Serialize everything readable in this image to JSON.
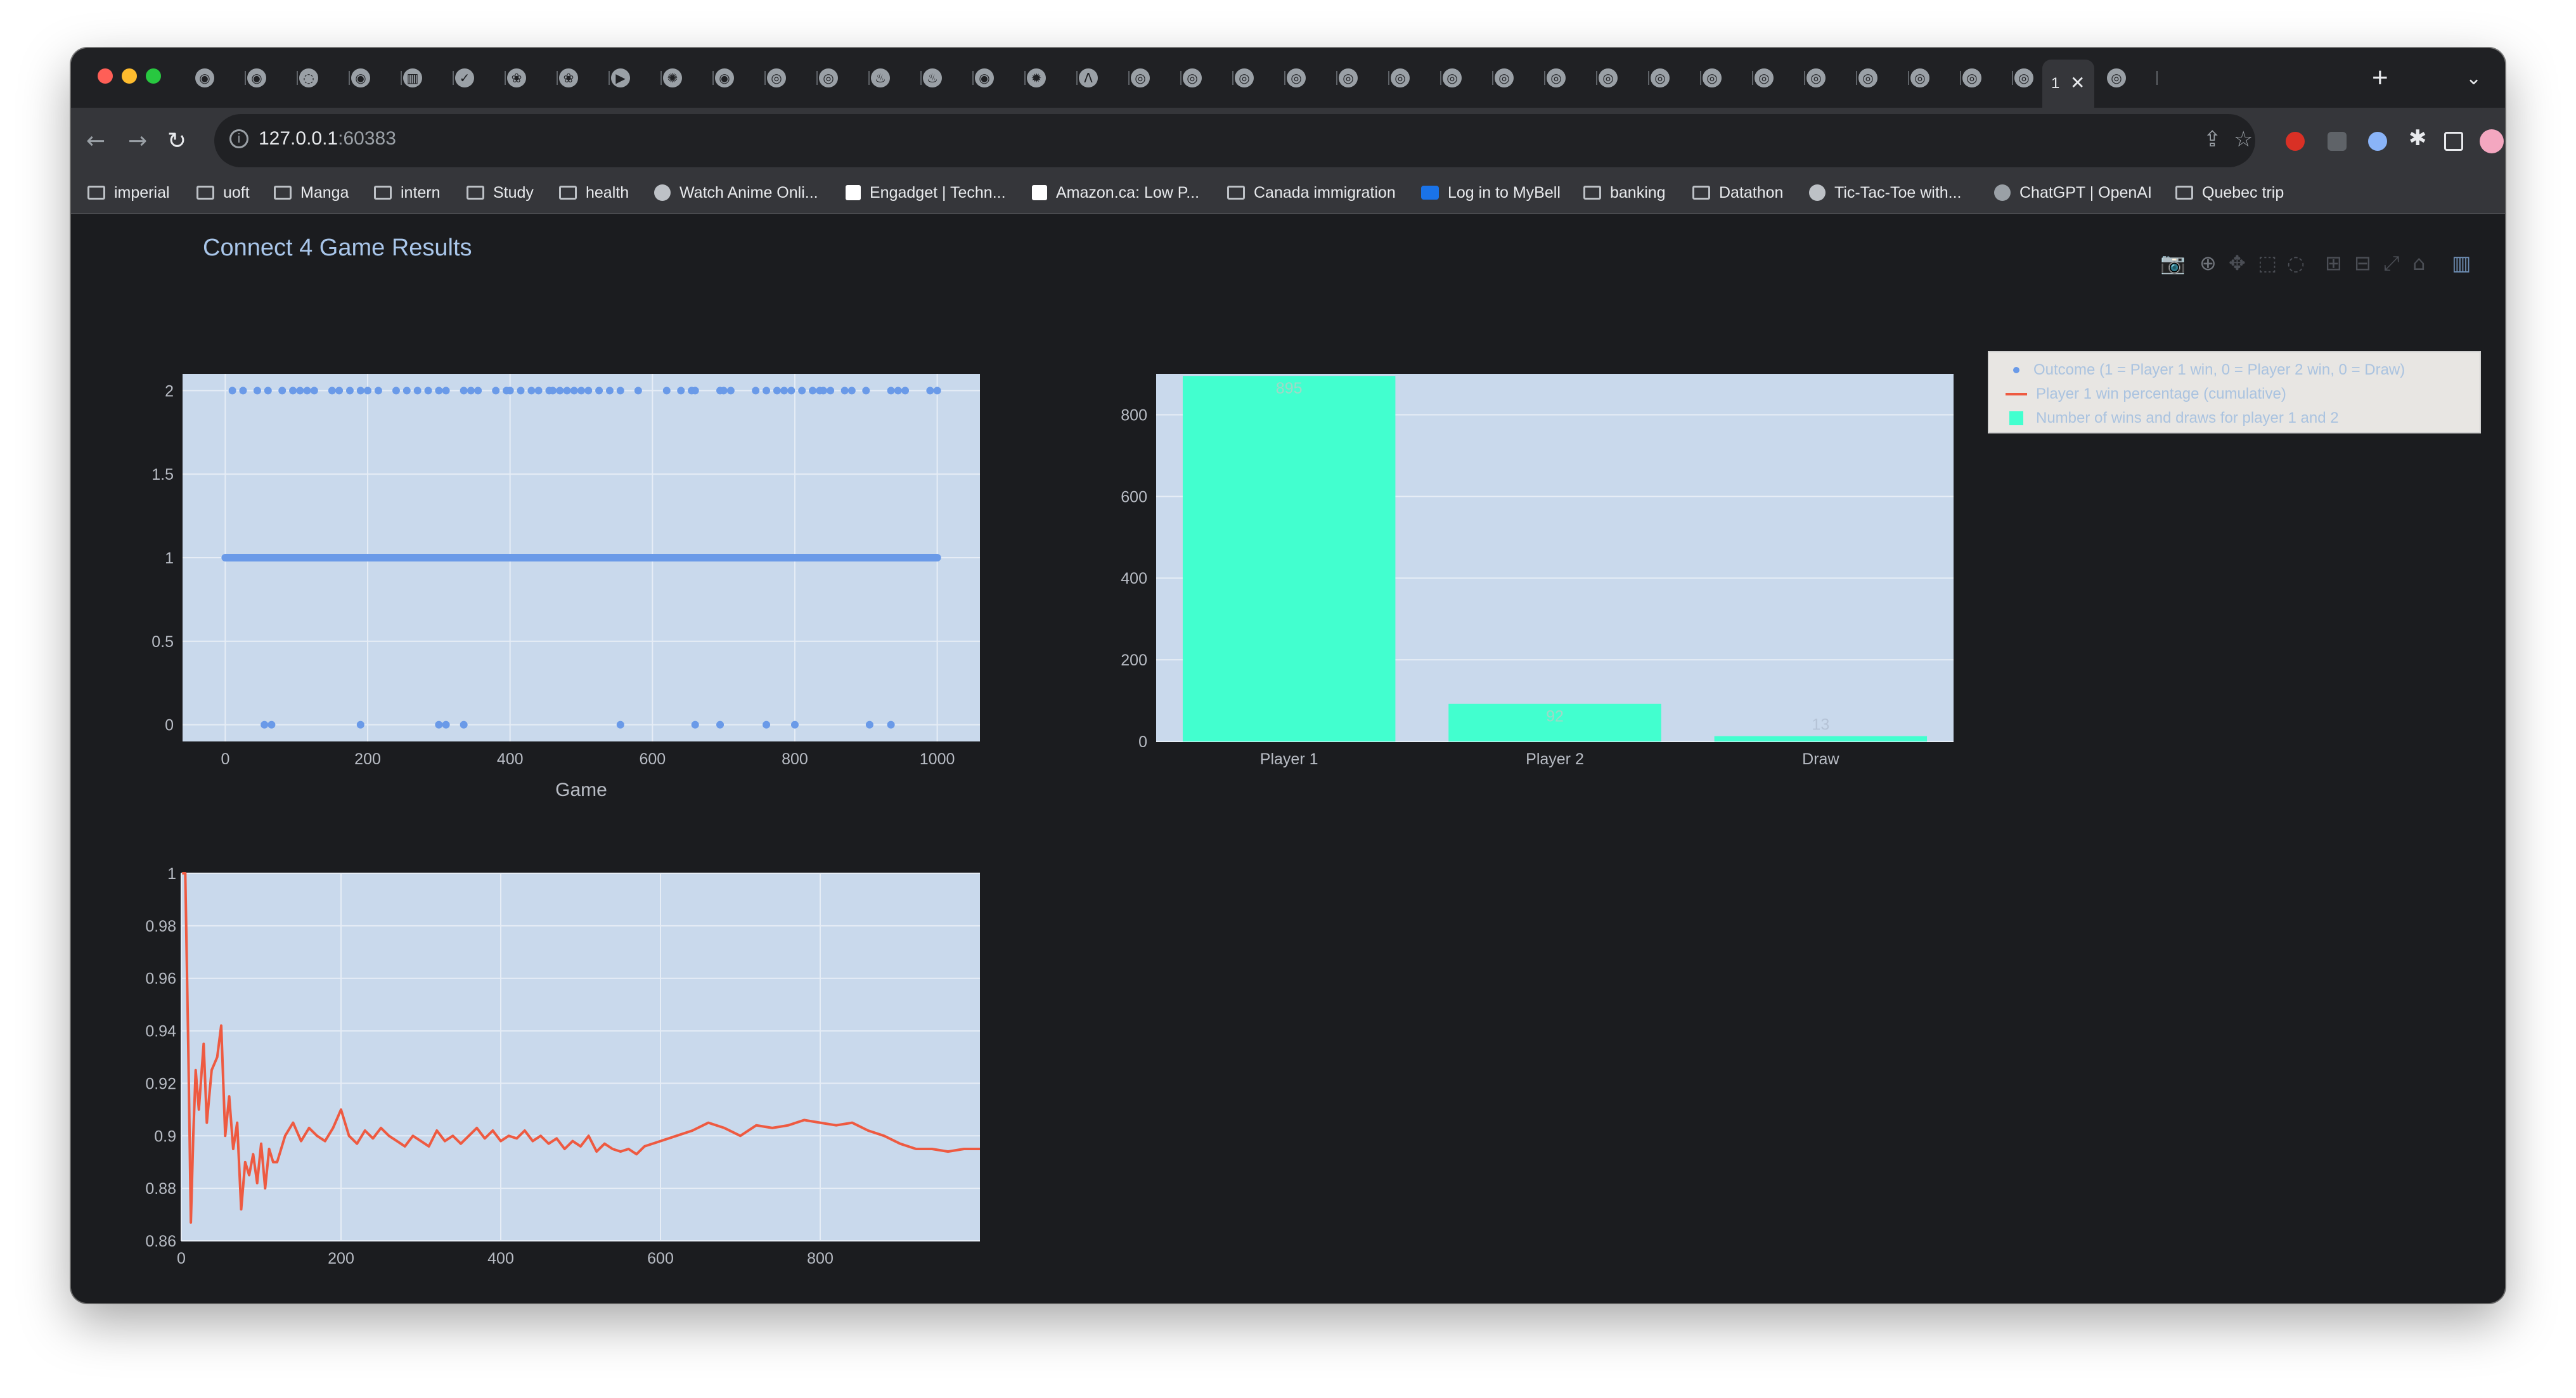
{
  "browser": {
    "active_tab_label": "1",
    "active_tab_close": "✕",
    "new_tab": "+",
    "tab_menu": "⌄",
    "url_host": "127.0.0.1",
    "url_port": ":60383",
    "nav": {
      "back": "←",
      "forward": "→",
      "reload": "↻"
    },
    "bookmarks": [
      {
        "label": "imperial",
        "icon": "folder-icon"
      },
      {
        "label": "uoft",
        "icon": "folder-icon"
      },
      {
        "label": "Manga",
        "icon": "folder-icon"
      },
      {
        "label": "intern",
        "icon": "folder-icon"
      },
      {
        "label": "Study",
        "icon": "folder-icon"
      },
      {
        "label": "health",
        "icon": "folder-icon"
      },
      {
        "label": "Watch Anime Onli...",
        "icon": "globe-icon"
      },
      {
        "label": "Engadget | Techn...",
        "icon": "engadget-icon"
      },
      {
        "label": "Amazon.ca: Low P...",
        "icon": "amazon-icon"
      },
      {
        "label": "Canada immigration",
        "icon": "folder-icon"
      },
      {
        "label": "Log in to MyBell",
        "icon": "bell-icon"
      },
      {
        "label": "banking",
        "icon": "folder-icon"
      },
      {
        "label": "Datathon",
        "icon": "folder-icon"
      },
      {
        "label": "Tic-Tac-Toe with...",
        "icon": "globe-icon"
      },
      {
        "label": "ChatGPT | OpenAI",
        "icon": "openai-icon"
      },
      {
        "label": "Quebec trip",
        "icon": "folder-icon"
      }
    ]
  },
  "page": {
    "title": "Connect 4 Game Results"
  },
  "legend": [
    "Outcome (1 = Player 1 win, 0 = Player 2 win, 0 = Draw)",
    "Player 1 win percentage (cumulative)",
    "Number of wins and draws for player 1 and 2"
  ],
  "colors": {
    "outcome": "#6a9ae8",
    "winpct": "#ee5a41",
    "bars": "#42ffcf",
    "plot_bg": "#c9d9ec"
  },
  "chart_data": [
    {
      "type": "scatter",
      "series_name": "Outcome (1 = Player 1 win, 0 = Player 2 win, 0 = Draw)",
      "xlabel": "Game",
      "xlim": [
        -60,
        1060
      ],
      "ylim": [
        -0.1,
        2.1
      ],
      "xticks": [
        0,
        200,
        400,
        600,
        800,
        1000
      ],
      "yticks": [
        0,
        0.5,
        1,
        1.5,
        2
      ],
      "ytick_labels": [
        "0",
        "0.5",
        "1",
        "1.5",
        "2"
      ],
      "y1_range": [
        0,
        1000
      ],
      "y2_points": [
        10,
        25,
        45,
        60,
        80,
        95,
        105,
        115,
        125,
        150,
        160,
        175,
        190,
        200,
        215,
        240,
        255,
        270,
        285,
        300,
        310,
        335,
        345,
        355,
        380,
        395,
        400,
        415,
        430,
        440,
        455,
        460,
        470,
        480,
        490,
        500,
        510,
        525,
        540,
        555,
        580,
        620,
        640,
        655,
        660,
        695,
        700,
        710,
        745,
        760,
        775,
        785,
        795,
        810,
        825,
        835,
        840,
        850,
        870,
        880,
        900,
        935,
        945,
        955,
        990,
        1000
      ],
      "y0_points": [
        55,
        65,
        190,
        300,
        310,
        335,
        555,
        660,
        695,
        760,
        800,
        905,
        935
      ]
    },
    {
      "type": "bar",
      "series_name": "Number of wins and draws for player 1 and 2",
      "categories": [
        "Player 1",
        "Player 2",
        "Draw"
      ],
      "values": [
        895,
        92,
        13
      ],
      "labels": [
        "895",
        "92",
        "13"
      ],
      "ylim": [
        0,
        900
      ],
      "yticks": [
        0,
        200,
        400,
        600,
        800
      ]
    },
    {
      "type": "line",
      "series_name": "Player 1 win percentage (cumulative)",
      "xlim": [
        0,
        1000
      ],
      "ylim": [
        0.86,
        1.0
      ],
      "xticks": [
        0,
        200,
        400,
        600,
        800
      ],
      "yticks": [
        0.86,
        0.88,
        0.9,
        0.92,
        0.94,
        0.96,
        0.98,
        1
      ],
      "ytick_labels": [
        "0.86",
        "0.88",
        "0.9",
        "0.92",
        "0.94",
        "0.96",
        "0.98",
        "1"
      ],
      "x": [
        1,
        5,
        9,
        12,
        15,
        18,
        22,
        28,
        32,
        38,
        45,
        50,
        55,
        60,
        65,
        70,
        75,
        80,
        85,
        90,
        95,
        100,
        105,
        110,
        115,
        120,
        130,
        140,
        150,
        160,
        170,
        180,
        190,
        200,
        210,
        220,
        230,
        240,
        250,
        260,
        270,
        280,
        290,
        300,
        310,
        320,
        330,
        340,
        350,
        360,
        370,
        380,
        390,
        400,
        410,
        420,
        430,
        440,
        450,
        460,
        470,
        480,
        490,
        500,
        510,
        520,
        530,
        540,
        550,
        560,
        570,
        580,
        600,
        620,
        640,
        660,
        680,
        700,
        720,
        740,
        760,
        780,
        800,
        820,
        840,
        860,
        880,
        900,
        920,
        940,
        960,
        980,
        1000
      ],
      "y": [
        1.0,
        1.0,
        0.93,
        0.867,
        0.9,
        0.925,
        0.91,
        0.935,
        0.905,
        0.925,
        0.93,
        0.942,
        0.9,
        0.915,
        0.895,
        0.905,
        0.872,
        0.89,
        0.885,
        0.893,
        0.882,
        0.897,
        0.88,
        0.895,
        0.89,
        0.89,
        0.9,
        0.905,
        0.898,
        0.903,
        0.9,
        0.898,
        0.903,
        0.91,
        0.9,
        0.897,
        0.902,
        0.899,
        0.903,
        0.9,
        0.898,
        0.896,
        0.9,
        0.898,
        0.896,
        0.902,
        0.898,
        0.9,
        0.897,
        0.9,
        0.903,
        0.899,
        0.902,
        0.898,
        0.9,
        0.899,
        0.902,
        0.898,
        0.9,
        0.897,
        0.899,
        0.895,
        0.898,
        0.896,
        0.9,
        0.894,
        0.897,
        0.895,
        0.894,
        0.895,
        0.893,
        0.896,
        0.898,
        0.9,
        0.902,
        0.905,
        0.903,
        0.9,
        0.904,
        0.903,
        0.904,
        0.906,
        0.905,
        0.904,
        0.905,
        0.902,
        0.9,
        0.897,
        0.895,
        0.895,
        0.894,
        0.895,
        0.895
      ]
    }
  ]
}
